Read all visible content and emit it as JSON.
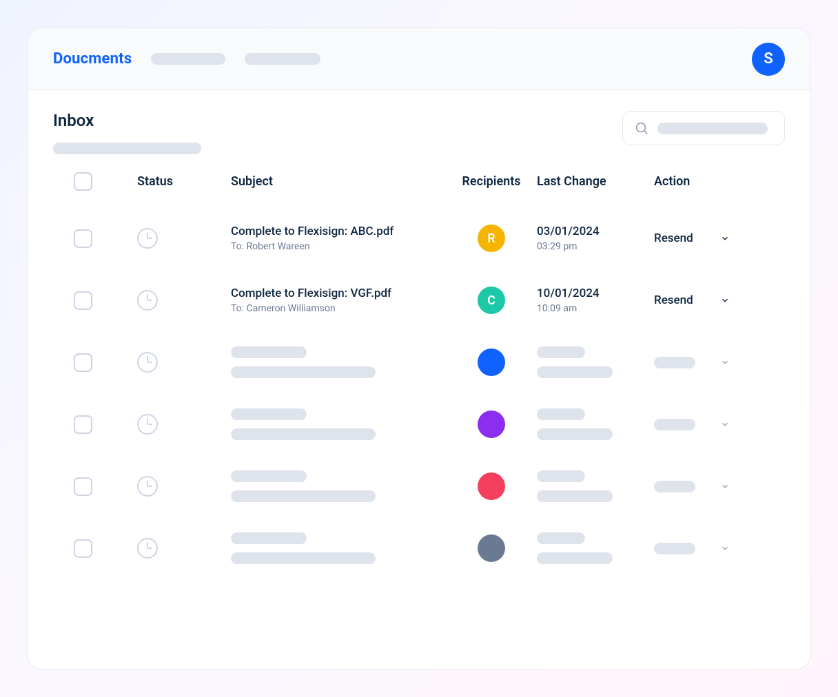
{
  "brand": "Doucments",
  "user_avatar_letter": "S",
  "colors": {
    "primary": "#0f62fe",
    "muted": "#cdd5e4"
  },
  "inbox": {
    "title": "Inbox",
    "search_placeholder": "",
    "columns": {
      "status": "Status",
      "subject": "Subject",
      "recipients": "Recipients",
      "last_change": "Last Change",
      "action": "Action"
    },
    "rows": [
      {
        "subject": "Complete to Flexisign: ABC.pdf",
        "to_prefix": "To: ",
        "to": "Robert Wareen",
        "recipient_letter": "R",
        "recipient_bg": "#f4b400",
        "date": "03/01/2024",
        "time": "03:29 pm",
        "action_label": "Resend"
      },
      {
        "subject": "Complete to Flexisign: VGF.pdf",
        "to_prefix": "To: ",
        "to": "Cameron Williamson",
        "recipient_letter": "C",
        "recipient_bg": "#1cc8a5",
        "date": "10/01/2024",
        "time": "10:09 am",
        "action_label": "Resend"
      }
    ],
    "placeholder_avatar_colors": [
      "#0f62fe",
      "#8b2ef0",
      "#f43f5e",
      "#6b7a93"
    ]
  }
}
